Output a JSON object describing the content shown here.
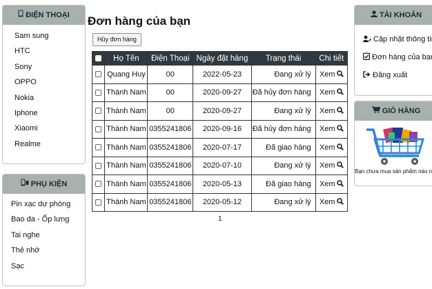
{
  "left_menu": {
    "phones": {
      "heading": "ĐIỆN THOẠI",
      "icon": "mobile-phone-icon",
      "items": [
        "Sam sung",
        "HTC",
        "Sony",
        "OPPO",
        "Nokia",
        "Iphone",
        "Xiaomi",
        "Realme"
      ]
    },
    "accessories": {
      "heading": "PHỤ KIỆN",
      "icon": "accessories-icon",
      "items": [
        "Pin xạc dự phòng",
        "Bao da - Ốp lưng",
        "Tai nghe",
        "Thẻ nhớ",
        "Sạc"
      ]
    }
  },
  "main": {
    "title": "Đơn hàng của bạn",
    "cancel_button": "Hủy đơn hàng",
    "table": {
      "headers": [
        "Họ Tên",
        "Điện Thoại",
        "Ngày đặt hàng",
        "Trạng thái",
        "Chi tiết"
      ],
      "rows": [
        {
          "name": "Quang Huy",
          "phone": "00",
          "date": "2022-05-23",
          "status": "Đang xử lý",
          "detail": "Xem"
        },
        {
          "name": "Thành Nam",
          "phone": "00",
          "date": "2020-09-27",
          "status": "Đã hủy đơn hàng",
          "detail": "Xem"
        },
        {
          "name": "Thành Nam",
          "phone": "00",
          "date": "2020-09-27",
          "status": "Đang xử lý",
          "detail": "Xem"
        },
        {
          "name": "Thành Nam",
          "phone": "0355241806",
          "date": "2020-09-16",
          "status": "Đã hủy đơn hàng",
          "detail": "Xem"
        },
        {
          "name": "Thành Nam",
          "phone": "0355241806",
          "date": "2020-07-17",
          "status": "Đã giao hàng",
          "detail": "Xem"
        },
        {
          "name": "Thành Nam",
          "phone": "0355241806",
          "date": "2020-07-10",
          "status": "Đang xử lý",
          "detail": "Xem"
        },
        {
          "name": "Thành Nam",
          "phone": "0355241806",
          "date": "2020-05-13",
          "status": "Đã giao hàng",
          "detail": "Xem"
        },
        {
          "name": "Thành Nam",
          "phone": "0355241806",
          "date": "2020-05-12",
          "status": "Đang xử lý",
          "detail": "Xem"
        }
      ]
    },
    "pagination": {
      "current": "1"
    }
  },
  "right_menu": {
    "account": {
      "heading": "TÀI KHOẢN",
      "icon": "user-icon",
      "items": [
        {
          "label": "Cập nhật thông tin",
          "icon": "user-edit-icon"
        },
        {
          "label": "Đơn hàng của bạn",
          "icon": "clipboard-check-icon"
        },
        {
          "label": "Đăng xuất",
          "icon": "sign-out-icon"
        }
      ]
    },
    "cart": {
      "heading": "GIỎ HÀNG",
      "icon": "shopping-cart-icon",
      "image": "shopping-cart-illustration",
      "empty_message": "Bạn chưa mua sản phẩm nào nha :D"
    }
  },
  "colors": {
    "panel_header_bg": "#a8b2ad",
    "table_header_bg": "#2f3a40"
  }
}
